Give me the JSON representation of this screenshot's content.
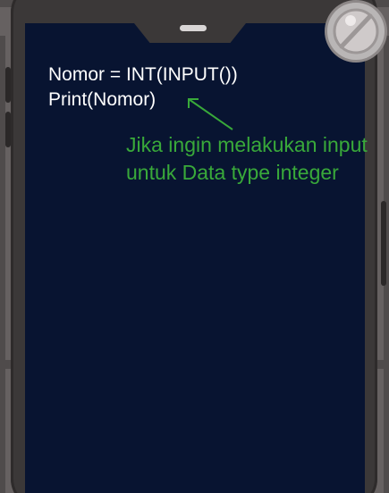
{
  "code": {
    "line1": "Nomor = INT(INPUT())",
    "line2": "Print(Nomor)"
  },
  "annotation": {
    "text": "Jika ingin melakukan input untuk Data type integer"
  },
  "colors": {
    "screen": "#081431",
    "code_text": "#ffffff",
    "annotation_text": "#39a93a",
    "frame": "#3b3838"
  },
  "icons": {
    "top_right_button": "magnifier-icon",
    "arrow": "arrow-icon"
  }
}
